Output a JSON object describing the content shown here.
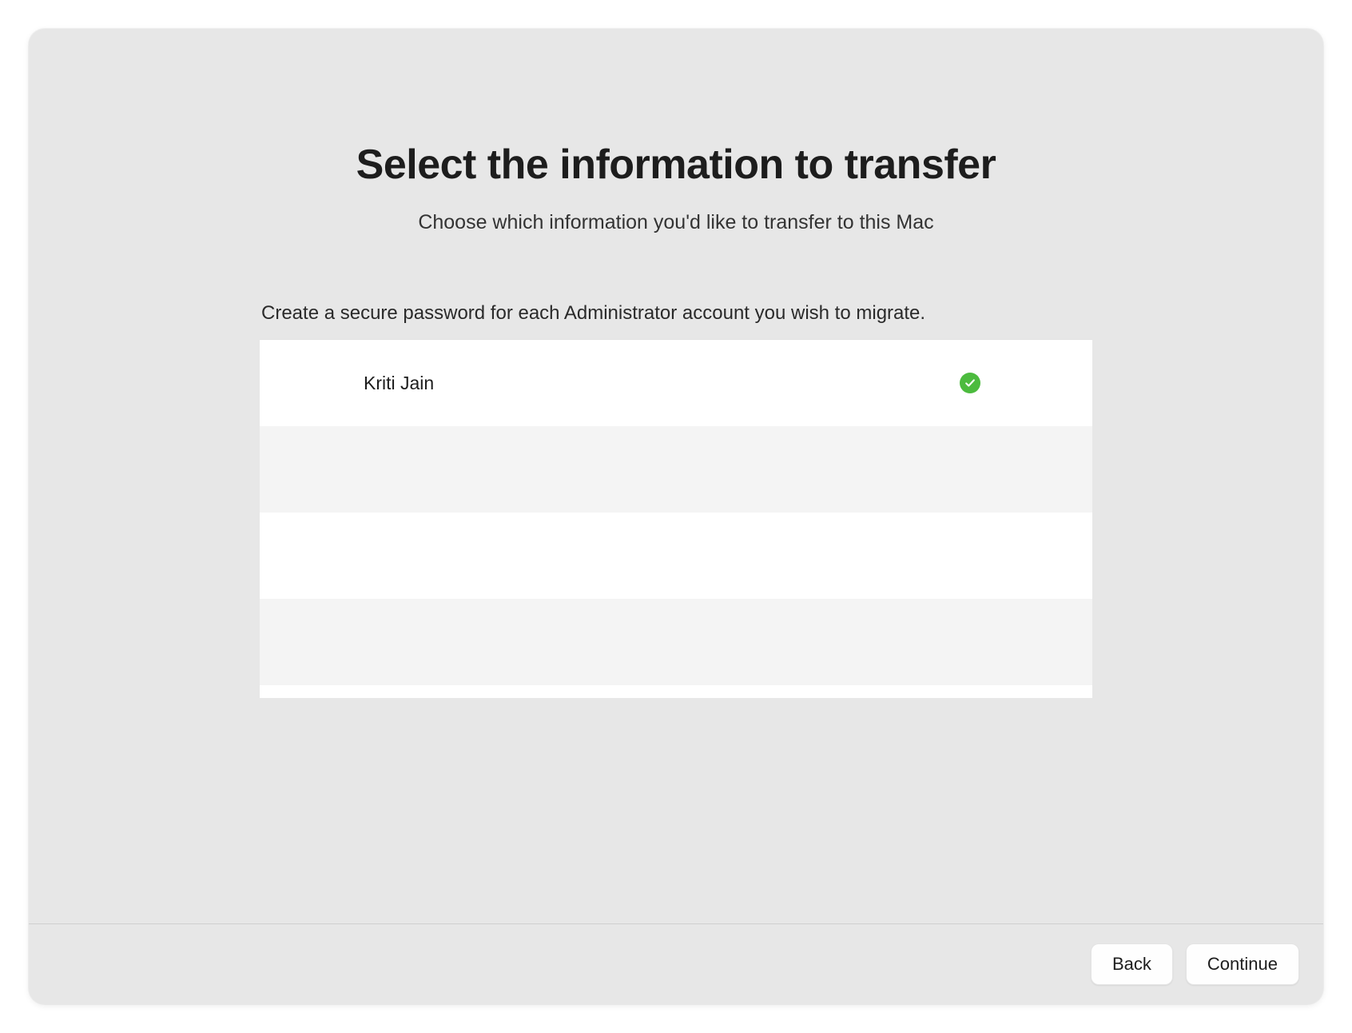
{
  "header": {
    "title": "Select the information to transfer",
    "subtitle": "Choose which information you'd like to transfer to this Mac",
    "instruction": "Create a secure password for each Administrator account you wish to migrate."
  },
  "accounts": [
    {
      "name": "Kriti Jain",
      "verified": true
    },
    {
      "name": "",
      "verified": false
    },
    {
      "name": "",
      "verified": false
    },
    {
      "name": "",
      "verified": false
    }
  ],
  "buttons": {
    "back": "Back",
    "continue": "Continue"
  }
}
